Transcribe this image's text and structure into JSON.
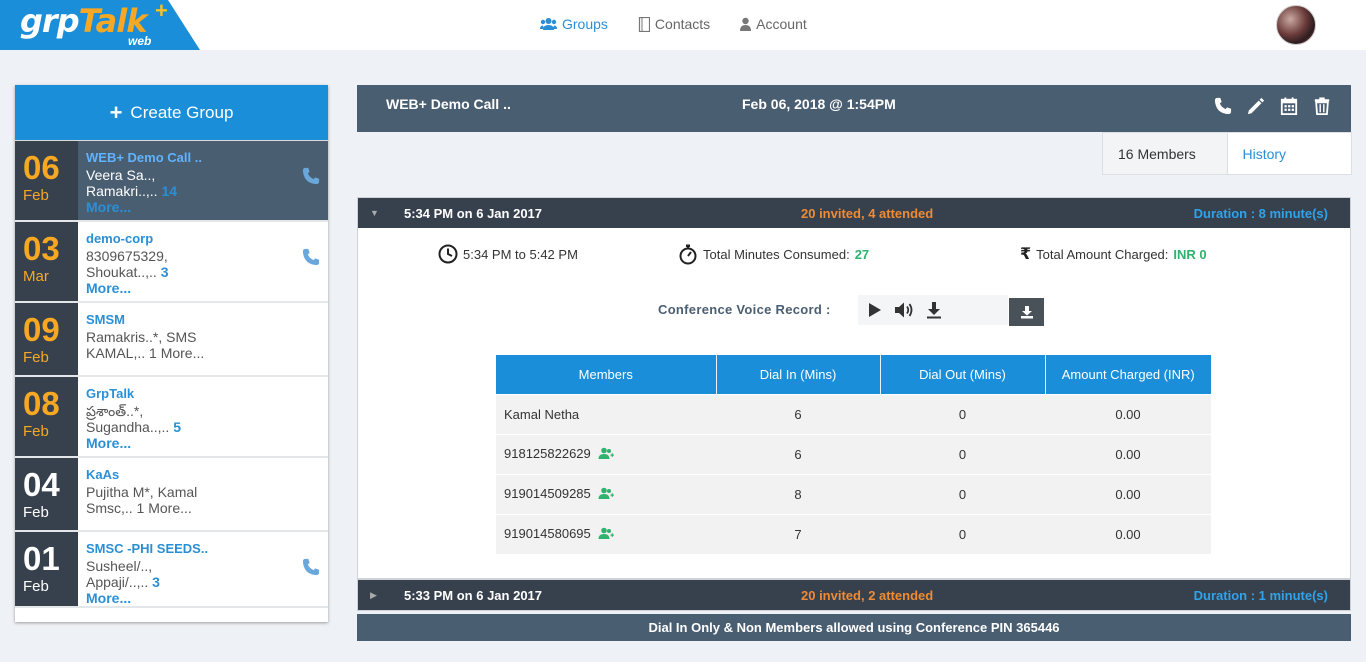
{
  "logo": {
    "grp": "grp",
    "talk": "Talk",
    "plus": "+",
    "sub": "web"
  },
  "nav": [
    {
      "label": "Groups",
      "icon": "users-icon",
      "active": true
    },
    {
      "label": "Contacts",
      "icon": "address-book-icon",
      "active": false
    },
    {
      "label": "Account",
      "icon": "user-icon",
      "active": false
    }
  ],
  "sidebar": {
    "create_label": "Create Group",
    "groups": [
      {
        "day": "06",
        "month": "Feb",
        "name": "WEB+ Demo Call ..",
        "line1": "Veera Sa..,",
        "line2": "Ramakri..,..",
        "count": "14",
        "more": "More...",
        "selected": true,
        "phone": true
      },
      {
        "day": "03",
        "month": "Mar",
        "name": "demo-corp",
        "line1": "8309675329,",
        "line2": "Shoukat..,..",
        "count": "3",
        "more": "More...",
        "selected": false,
        "phone": true
      },
      {
        "day": "09",
        "month": "Feb",
        "name": "SMSM",
        "line1": "Ramakris..*, SMS",
        "line2": "KAMAL,.. 1 More...",
        "count": "",
        "more": "",
        "selected": false,
        "phone": false
      },
      {
        "day": "08",
        "month": "Feb",
        "name": "GrpTalk",
        "line1": "ప్రశాంత్..*,",
        "line2": "Sugandha..,..",
        "count": "5",
        "more": "More...",
        "selected": false,
        "phone": false
      },
      {
        "day": "04",
        "month": "Feb",
        "name": "KaAs",
        "line1": "Pujitha M*, Kamal",
        "line2": "Smsc,.. 1 More...",
        "count": "",
        "more": "",
        "selected": false,
        "phone": false,
        "gray": true
      },
      {
        "day": "01",
        "month": "Feb",
        "name": "SMSC -PHI SEEDS..",
        "line1": "Susheel/..,",
        "line2": "Appaji/..,..",
        "count": "3",
        "more": "More...",
        "selected": false,
        "phone": true,
        "gray": true
      }
    ]
  },
  "main": {
    "title": "WEB+ Demo Call ..",
    "date": "Feb 06, 2018 @ 1:54PM",
    "tabs": {
      "members": "16 Members",
      "history": "History"
    }
  },
  "calls": [
    {
      "time": "5:34 PM on 6 Jan 2017",
      "invited": "20 invited, 4 attended",
      "duration": "Duration : 8 minute(s)",
      "range": "5:34 PM to 5:42 PM",
      "minutes_label": "Total Minutes Consumed:",
      "minutes": "27",
      "amount_label": "Total Amount Charged:",
      "amount": "INR 0",
      "voice_label": "Conference Voice Record :",
      "table_headers": [
        "Members",
        "Dial In (Mins)",
        "Dial Out (Mins)",
        "Amount Charged (INR)"
      ],
      "rows": [
        {
          "member": "Kamal Netha",
          "dial_in": "6",
          "dial_out": "0",
          "amount": "0.00",
          "add": false
        },
        {
          "member": "918125822629",
          "dial_in": "6",
          "dial_out": "0",
          "amount": "0.00",
          "add": true
        },
        {
          "member": "919014509285",
          "dial_in": "8",
          "dial_out": "0",
          "amount": "0.00",
          "add": true
        },
        {
          "member": "919014580695",
          "dial_in": "7",
          "dial_out": "0",
          "amount": "0.00",
          "add": true
        }
      ]
    },
    {
      "time": "5:33 PM on 6 Jan 2017",
      "invited": "20 invited, 2 attended",
      "duration": "Duration : 1 minute(s)"
    }
  ],
  "footer": "Dial In Only & Non Members allowed using Conference PIN 365446",
  "colors": {
    "accent": "#1a8ed8",
    "header": "#4a5e72",
    "dark": "#37414d",
    "orange": "#f7a823",
    "green": "#2eb26e"
  }
}
